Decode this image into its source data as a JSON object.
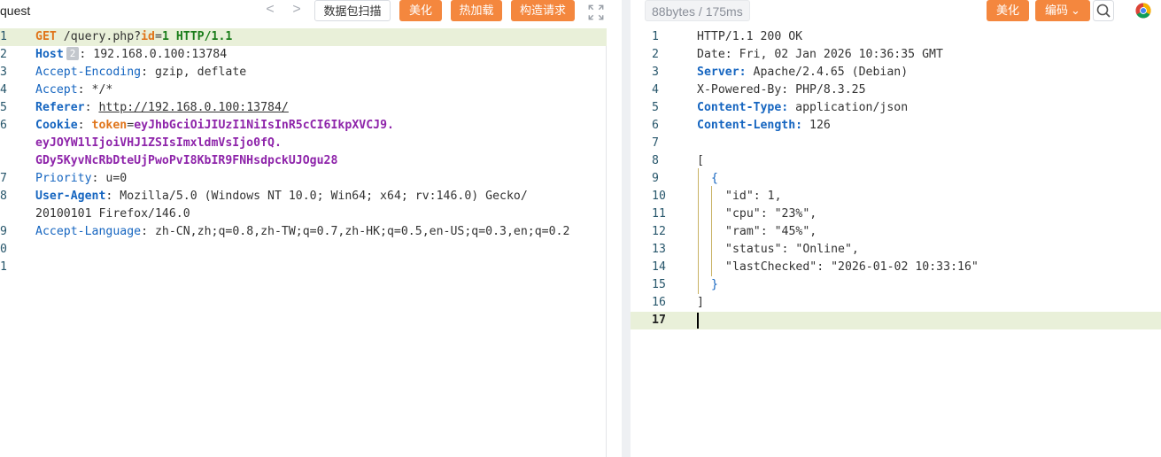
{
  "request": {
    "title": "quest",
    "nav": {
      "prev": "<",
      "next": ">"
    },
    "buttons": {
      "scan": "数据包扫描",
      "beautify": "美化",
      "hotload": "热加载",
      "construct": "构造请求"
    },
    "line_numbers": [
      "1",
      "2",
      "3",
      "4",
      "5",
      "6",
      "",
      "",
      "7",
      "8",
      "9",
      "0",
      "1"
    ],
    "lines": {
      "l1": {
        "method": "GET",
        "path": " /query.php?",
        "param_key": "id",
        "eq": "=",
        "param_val": "1",
        "version": " HTTP/1.1"
      },
      "l2": {
        "name": "Host",
        "badge": "2",
        "colon": ":",
        "value": " 192.168.0.100:13784"
      },
      "l3": {
        "name": "Accept-Encoding",
        "colon": ":",
        "value": " gzip, deflate"
      },
      "l4": {
        "name": "Accept",
        "colon": ":",
        "value": " */*"
      },
      "l5": {
        "name": "Referer",
        "colon": ": ",
        "value": "http://192.168.0.100:13784/"
      },
      "l6": {
        "name": "Cookie",
        "colon": ": ",
        "key": "token",
        "eq": "=",
        "v1": "eyJhbGciOiJIUzI1NiIsInR5cCI6IkpXVCJ9.",
        "v2": "eyJOYW1lIjoiVHJ1ZSIsImxldmVsIjo0fQ.",
        "v3": "GDy5KyvNcRbDteUjPwoPvI8KbIR9FNHsdpckUJOgu28"
      },
      "l7": {
        "name": "Priority",
        "colon": ":",
        "value": " u=0"
      },
      "l8": {
        "name": "User-Agent",
        "colon": ":",
        "value": " Mozilla/5.0 (Windows NT 10.0; Win64; x64; rv:146.0) Gecko/",
        "value2": "20100101 Firefox/146.0"
      },
      "l9": {
        "name": "Accept-Language",
        "colon": ":",
        "value": " zh-CN,zh;q=0.8,zh-TW;q=0.7,zh-HK;q=0.5,en-US;q=0.3,en;q=0.2"
      }
    }
  },
  "response": {
    "stats": "88bytes / 175ms",
    "buttons": {
      "beautify": "美化",
      "encode": "编码"
    },
    "encode_caret": "⌄",
    "line_numbers": [
      "1",
      "2",
      "3",
      "4",
      "5",
      "6",
      "7",
      "8",
      "9",
      "10",
      "11",
      "12",
      "13",
      "14",
      "15",
      "16",
      "17"
    ],
    "lines": {
      "r1": {
        "text": "HTTP/1.1 200 OK"
      },
      "r2": {
        "text": "Date: Fri, 02 Jan 2026 10:36:35 GMT"
      },
      "r3": {
        "name": "Server:",
        "value": " Apache/2.4.65 (Debian)"
      },
      "r4": {
        "text": "X-Powered-By: PHP/8.3.25"
      },
      "r5": {
        "name": "Content-Type:",
        "value": " application/json"
      },
      "r6": {
        "name": "Content-Length:",
        "value": " 126"
      },
      "r8": {
        "text": "["
      },
      "r9": {
        "text": "{"
      },
      "r10": {
        "text": "\"id\": 1,"
      },
      "r11": {
        "text": "\"cpu\": \"23%\","
      },
      "r12": {
        "text": "\"ram\": \"45%\","
      },
      "r13": {
        "text": "\"status\": \"Online\","
      },
      "r14": {
        "text": "\"lastChecked\": \"2026-01-02 10:33:16\""
      },
      "r15": {
        "text": "}"
      },
      "r16": {
        "text": "]"
      }
    }
  }
}
